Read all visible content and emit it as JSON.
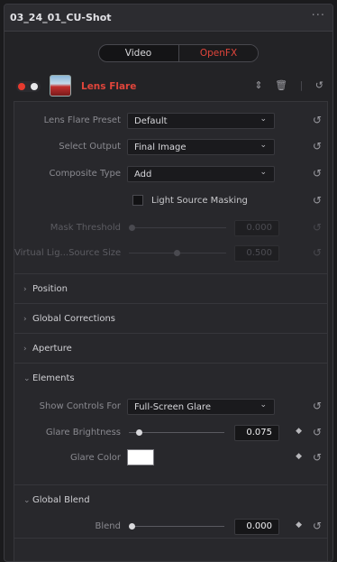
{
  "window": {
    "title": "03_24_01_CU-Shot",
    "menu_icon": "more-dots-icon"
  },
  "tabs": [
    {
      "label": "Video",
      "active": false
    },
    {
      "label": "OpenFX",
      "active": true
    }
  ],
  "effect": {
    "name": "Lens Flare",
    "enabled": true,
    "accent_color": "#e0453b",
    "tools": {
      "stepper_icon": "updown-icon",
      "delete_icon": "trash-icon",
      "reset_icon": "reset-icon"
    }
  },
  "params": {
    "preset": {
      "label": "Lens Flare Preset",
      "value": "Default"
    },
    "output": {
      "label": "Select Output",
      "value": "Final Image"
    },
    "composite": {
      "label": "Composite Type",
      "value": "Add"
    },
    "masking": {
      "label": "Light Source Masking",
      "checked": false
    },
    "mask_threshold": {
      "label": "Mask Threshold",
      "value": "0.000"
    },
    "virtual_light": {
      "label": "Virtual Lig...Source Size",
      "value": "0.500"
    }
  },
  "sections": {
    "position": "Position",
    "global_corrections": "Global Corrections",
    "aperture": "Aperture",
    "elements": "Elements",
    "global_blend": "Global Blend"
  },
  "elements": {
    "show_controls": {
      "label": "Show Controls For",
      "value": "Full-Screen Glare"
    },
    "glare_brightness": {
      "label": "Glare Brightness",
      "value": "0.075"
    },
    "glare_color": {
      "label": "Glare Color",
      "color": "#ffffff"
    }
  },
  "blend": {
    "label": "Blend",
    "value": "0.000"
  }
}
